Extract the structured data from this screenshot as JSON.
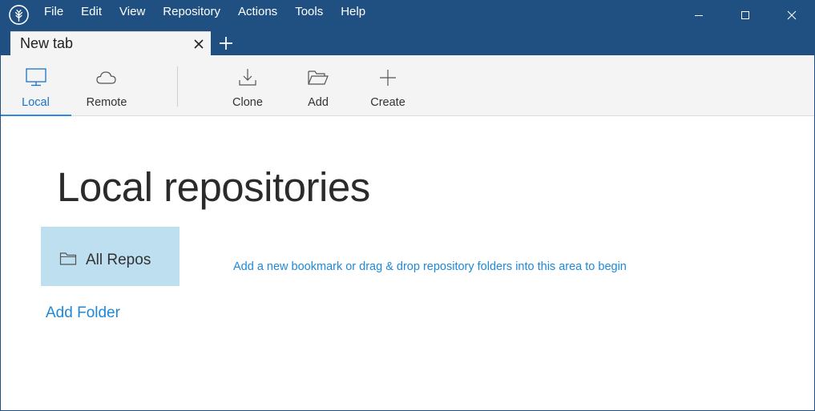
{
  "menu": [
    "File",
    "Edit",
    "View",
    "Repository",
    "Actions",
    "Tools",
    "Help"
  ],
  "tab": {
    "label": "New tab"
  },
  "toolbar": {
    "local": "Local",
    "remote": "Remote",
    "clone": "Clone",
    "add": "Add",
    "create": "Create"
  },
  "main": {
    "title": "Local repositories",
    "all_repos": "All Repos",
    "add_folder": "Add Folder",
    "hint": "Add a new bookmark or drag & drop repository folders into this area to begin"
  },
  "colors": {
    "titlebar": "#205081",
    "accent": "#1f88d8",
    "card": "#bddff0"
  },
  "icons": {
    "app": "sourcetree-logo-icon",
    "local": "monitor-icon",
    "remote": "cloud-icon",
    "clone": "download-icon",
    "add": "folder-open-icon",
    "create": "plus-icon",
    "repo": "folder-icon"
  }
}
